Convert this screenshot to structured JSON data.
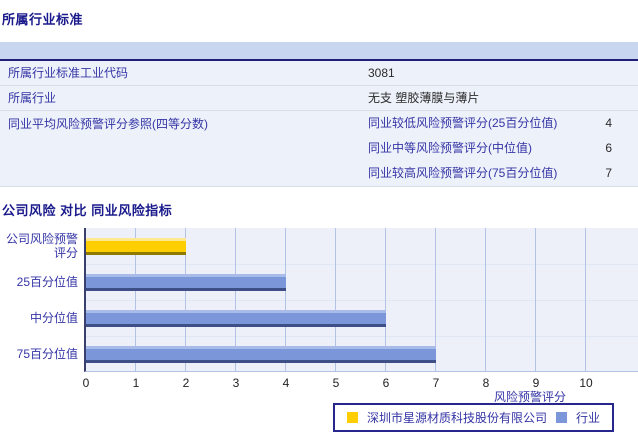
{
  "section1": {
    "title": "所属行业标准"
  },
  "table": {
    "rows": [
      {
        "label": "所属行业标准工业代码",
        "value": "3081"
      },
      {
        "label": "所属行业",
        "value": "无支 塑胶薄膜与薄片"
      },
      {
        "label": "同业平均风险预警评分参照(四等分数)",
        "subrows": [
          {
            "label": "同业较低风险预警评分(25百分位值)",
            "value": "4"
          },
          {
            "label": "同业中等风险预警评分(中位值)",
            "value": "6"
          },
          {
            "label": "同业较高风险预警评分(75百分位值)",
            "value": "7"
          }
        ]
      }
    ]
  },
  "section2": {
    "title": "公司风险 对比 同业风险指标"
  },
  "chart_data": {
    "type": "bar",
    "orientation": "horizontal",
    "title": "公司风险 对比 同业风险指标",
    "categories": [
      "公司风险预警评分",
      "25百分位值",
      "中分位值",
      "75百分位值"
    ],
    "series": [
      {
        "name": "深圳市星源材质科技股份有限公司",
        "color": "#FFCE00",
        "color_light": "#FFE990",
        "color_dark": "#8F7A00",
        "values": [
          2,
          null,
          null,
          null
        ]
      },
      {
        "name": "行业",
        "color": "#7B96D9",
        "color_light": "#A9BCE9",
        "color_dark": "#3E4F87",
        "values": [
          null,
          4,
          6,
          7
        ]
      }
    ],
    "xlabel": "风险预警评分",
    "xlim": [
      0,
      11
    ],
    "xticks": [
      0,
      1,
      2,
      3,
      4,
      5,
      6,
      7,
      8,
      9,
      10
    ],
    "grid": true,
    "legend_position": "bottom"
  },
  "colors": {
    "title_text": "#1A1A8C",
    "label_text": "#3434A6",
    "value_text": "#2B2B2B",
    "table_header_bg": "#C9D6EF",
    "table_header_border": "#1F1F78",
    "row_bg": "#EDF1F9",
    "plot_bg": "#EDF0F8",
    "gridline": "#B3C3E6",
    "axis_line": "#39406E",
    "legend_border": "#26268C"
  }
}
